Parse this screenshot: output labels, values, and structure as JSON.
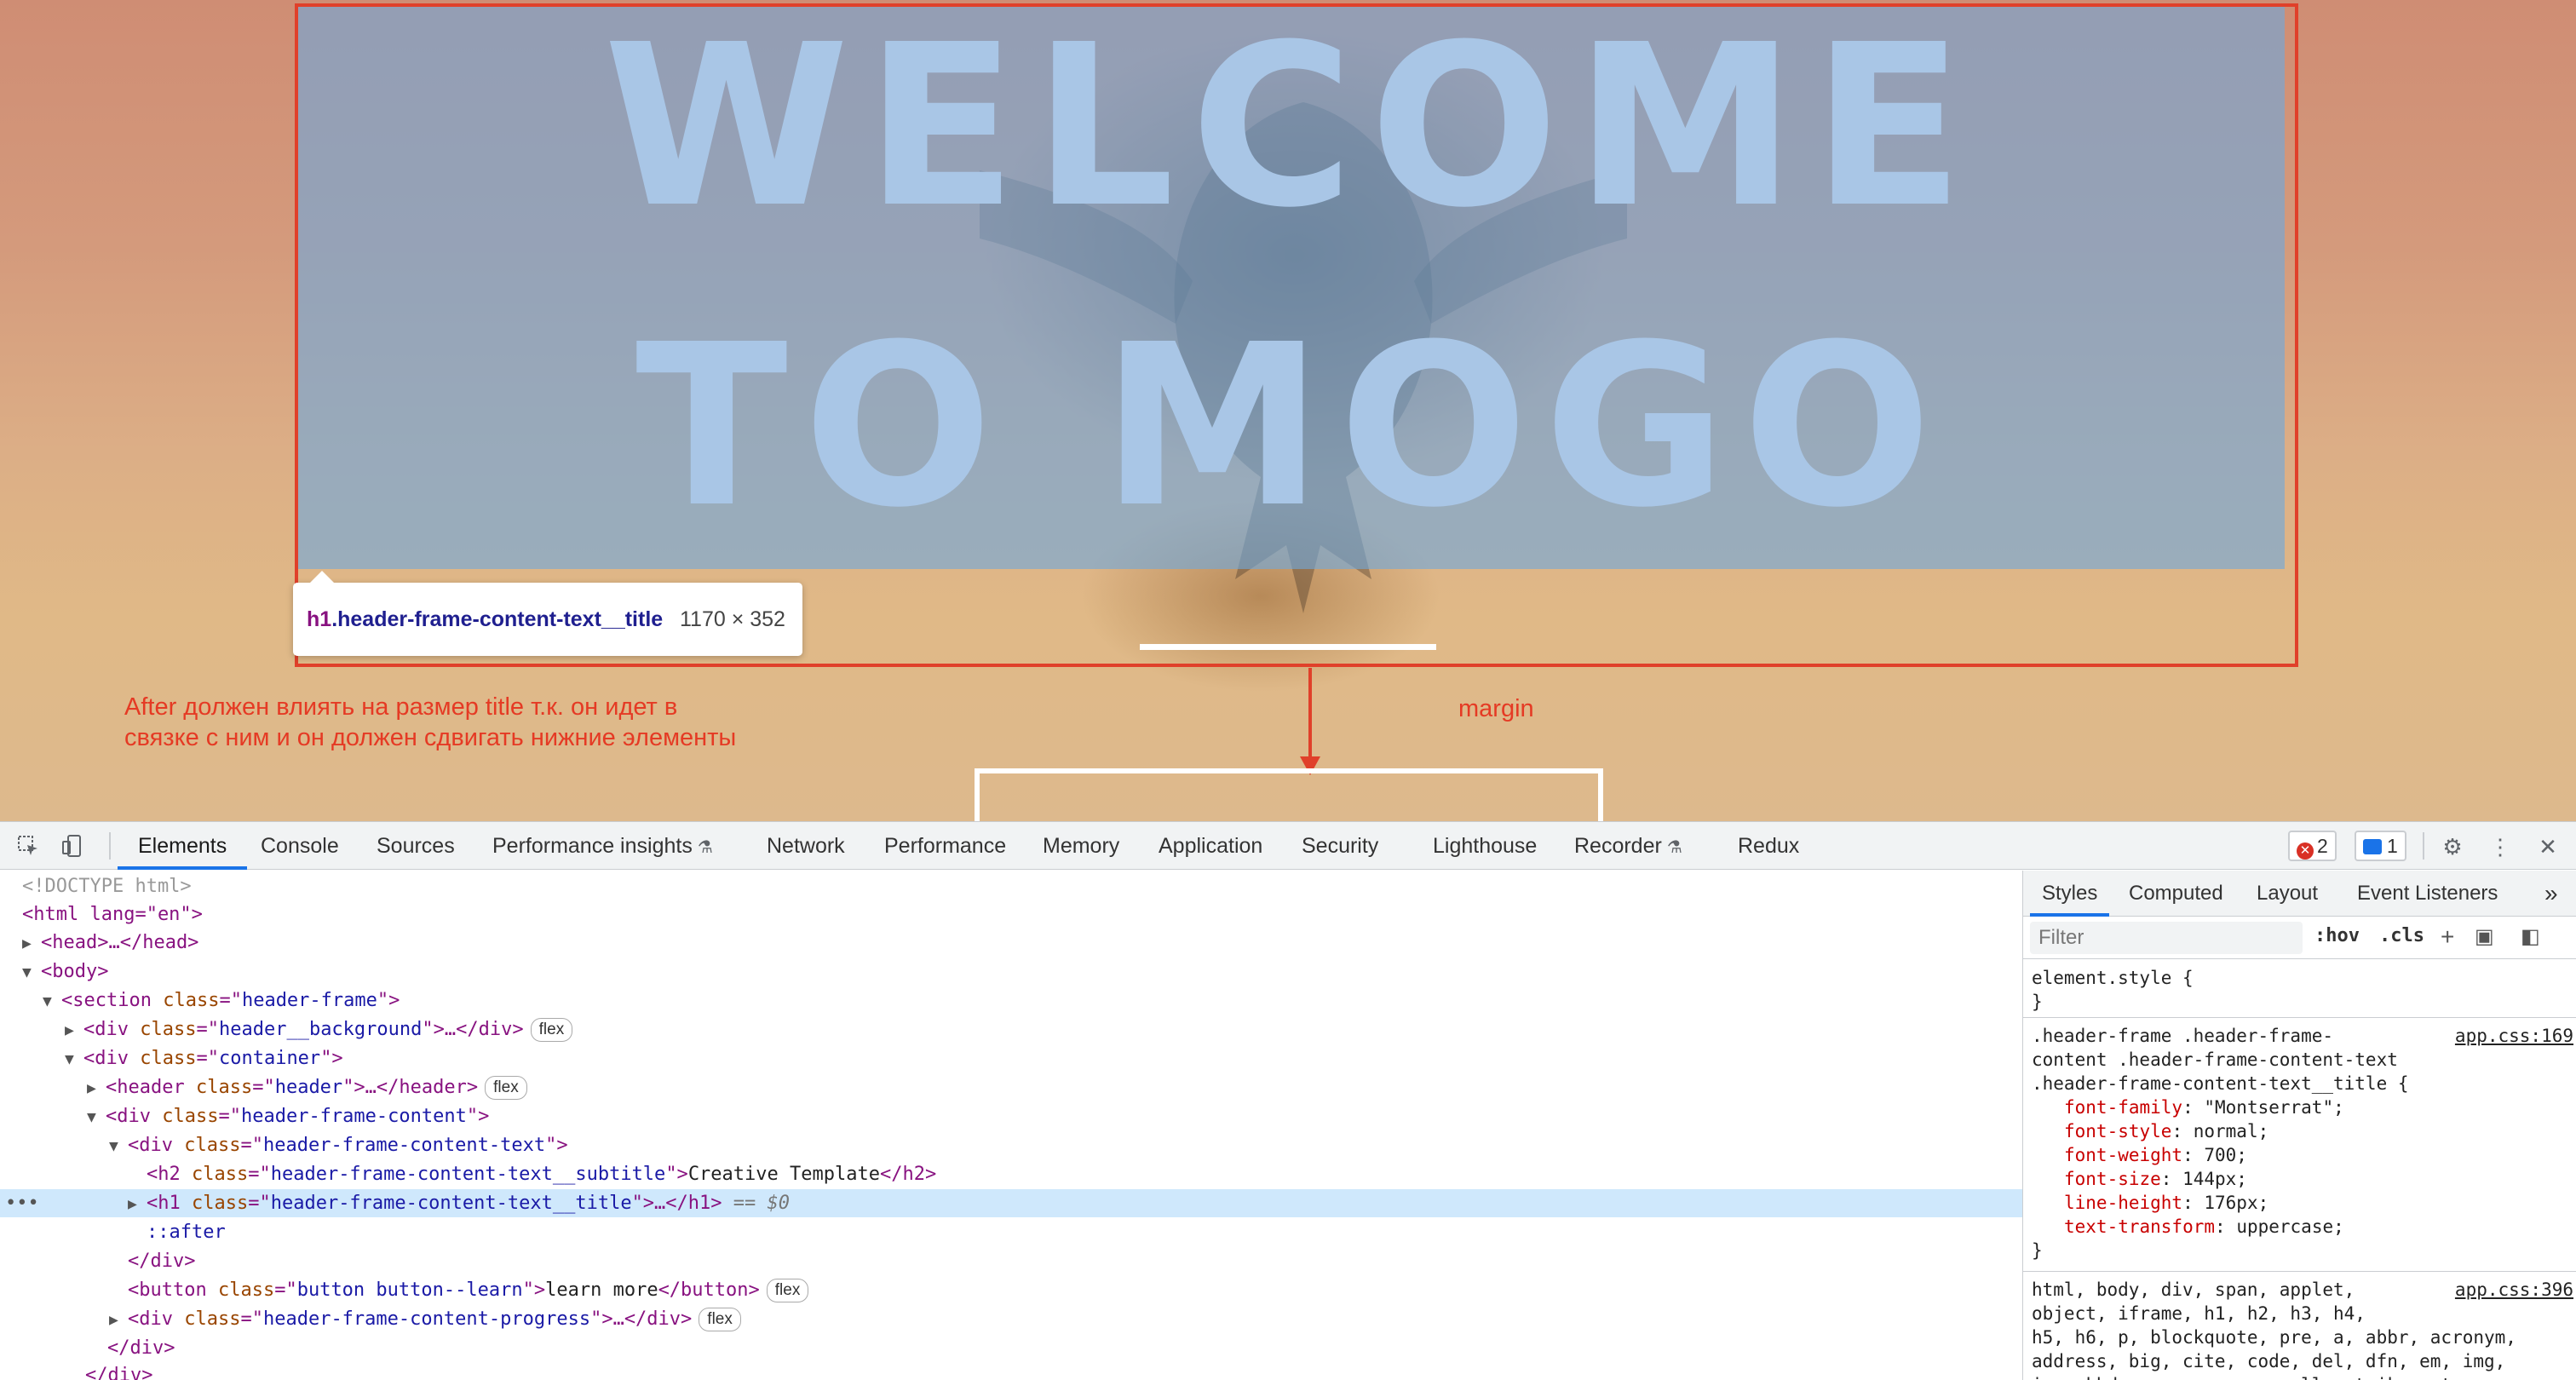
{
  "page": {
    "title_line_1": "WELCOME",
    "title_line_2": "TO MOGO"
  },
  "inspect_tooltip": {
    "tag": "h1",
    "selector": ".header-frame-content-text__title",
    "size": "1170 × 352"
  },
  "annotations": {
    "note_line_1": "After должен влиять на размер title т.к. он идет в",
    "note_line_2": "связке с ним и он должен сдвигать нижние элементы",
    "margin_label": "margin"
  },
  "devtools": {
    "tabs": [
      "Elements",
      "Console",
      "Sources",
      "Performance insights",
      "Network",
      "Performance",
      "Memory",
      "Application",
      "Security",
      "Lighthouse",
      "Recorder",
      "Redux"
    ],
    "active_tab": "Elements",
    "errors_count": "2",
    "messages_count": "1",
    "icons": [
      "inspect-icon",
      "device-toggle-icon",
      "flask-icon",
      "error-icon",
      "message-icon",
      "gear-icon",
      "kebab-menu-icon",
      "close-icon"
    ],
    "dom": {
      "doctype": "<!DOCTYPE html>",
      "html_open": "<html lang=\"en\">",
      "head": "<head>…</head>",
      "body_open": "<body>",
      "section_tag": "section",
      "section_class": "header-frame",
      "bg_tag": "div",
      "bg_class": "header__background",
      "flex_label": "flex",
      "container_class": "container",
      "header_class": "header",
      "content_class": "header-frame-content",
      "content_text_class": "header-frame-content-text",
      "h2_class": "header-frame-content-text__subtitle",
      "h2_text": "Creative Template",
      "h1_class": "header-frame-content-text__title",
      "selected_marker": "== $0",
      "after_pseudo": "::after",
      "div_close": "</div>",
      "button_class": "button button--learn",
      "button_text": "learn more",
      "progress_class": "header-frame-content-progress"
    },
    "styles": {
      "tabs": [
        "Styles",
        "Computed",
        "Layout",
        "Event Listeners"
      ],
      "active_tab": "Styles",
      "filter_placeholder": "Filter",
      "hov": ":hov",
      "cls": ".cls",
      "element_style": "element.style {",
      "close_brace": "}",
      "rule1_selector_1": ".header-frame .header-frame-",
      "rule1_selector_2": "content .header-frame-content-text",
      "rule1_selector_3": ".header-frame-content-text__title {",
      "rule1_source": "app.css:169",
      "rule1_decls": [
        {
          "prop": "font-family",
          "value": "\"Montserrat\";"
        },
        {
          "prop": "font-style",
          "value": "normal;"
        },
        {
          "prop": "font-weight",
          "value": "700;"
        },
        {
          "prop": "font-size",
          "value": "144px;"
        },
        {
          "prop": "line-height",
          "value": "176px;"
        },
        {
          "prop": "text-transform",
          "value": "uppercase;"
        }
      ],
      "rule2_source": "app.css:396",
      "rule2_lines": [
        "html, body, div, span, applet,",
        "object, iframe, h1, h2, h3, h4,",
        "h5, h6, p, blockquote, pre, a, abbr, acronym,",
        "address, big, cite, code, del, dfn, em, img,",
        "ins, kbd, q, s, samp, small, strike, strong,"
      ]
    }
  },
  "colors": {
    "highlight": "#6fa8dc",
    "annotation": "#e53a24",
    "accent": "#1a73e8"
  }
}
